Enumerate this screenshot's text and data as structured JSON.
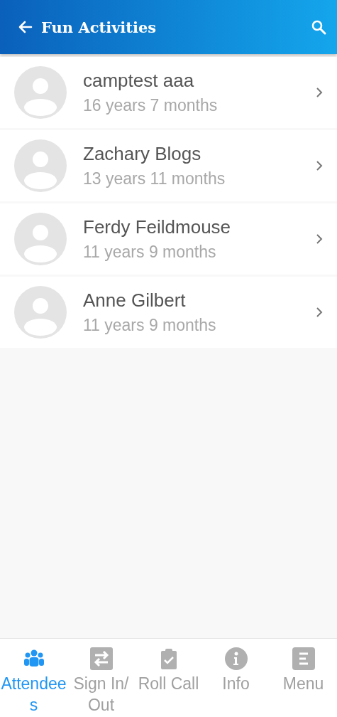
{
  "header": {
    "title": "Fun Activities"
  },
  "attendees": [
    {
      "name": "camptest aaa",
      "age": "16 years 7 months"
    },
    {
      "name": "Zachary Blogs",
      "age": "13 years 11 months"
    },
    {
      "name": "Ferdy Feildmouse",
      "age": "11 years 9 months"
    },
    {
      "name": "Anne Gilbert",
      "age": "11 years 9 months"
    }
  ],
  "tabs": [
    {
      "label": "Attendees",
      "kind": "people",
      "selected": true
    },
    {
      "label": "Sign In/ Out",
      "kind": "swap",
      "selected": false
    },
    {
      "label": "Roll Call",
      "kind": "clipboard",
      "selected": false
    },
    {
      "label": "Info",
      "kind": "info",
      "selected": false
    },
    {
      "label": "Menu",
      "kind": "menu",
      "selected": false
    }
  ]
}
